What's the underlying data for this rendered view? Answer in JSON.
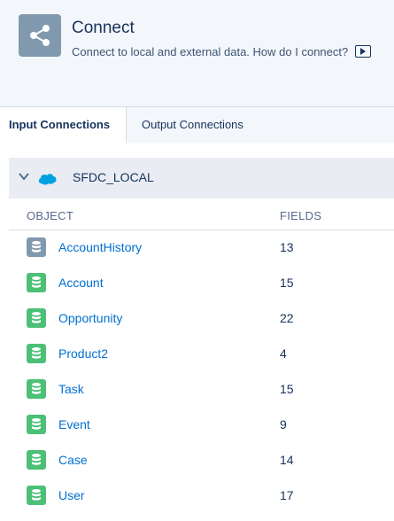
{
  "header": {
    "title": "Connect",
    "subtitle": "Connect to local and external data.",
    "help_link": "How do I connect?",
    "icon": "share-icon",
    "icon_color": "#8199af"
  },
  "tabs": [
    {
      "label": "Input Connections",
      "active": true
    },
    {
      "label": "Output Connections",
      "active": false
    }
  ],
  "connection": {
    "name": "SFDC_LOCAL",
    "expanded": true,
    "logo": "salesforce-logo"
  },
  "table": {
    "columns": [
      "OBJECT",
      "FIELDS"
    ],
    "rows": [
      {
        "name": "AccountHistory",
        "fields": "13",
        "icon_color": "#8199af"
      },
      {
        "name": "Account",
        "fields": "15",
        "icon_color": "#4bc076"
      },
      {
        "name": "Opportunity",
        "fields": "22",
        "icon_color": "#4bc076"
      },
      {
        "name": "Product2",
        "fields": "4",
        "icon_color": "#4bc076"
      },
      {
        "name": "Task",
        "fields": "15",
        "icon_color": "#4bc076"
      },
      {
        "name": "Event",
        "fields": "9",
        "icon_color": "#4bc076"
      },
      {
        "name": "Case",
        "fields": "14",
        "icon_color": "#4bc076"
      },
      {
        "name": "User",
        "fields": "17",
        "icon_color": "#4bc076"
      }
    ]
  }
}
